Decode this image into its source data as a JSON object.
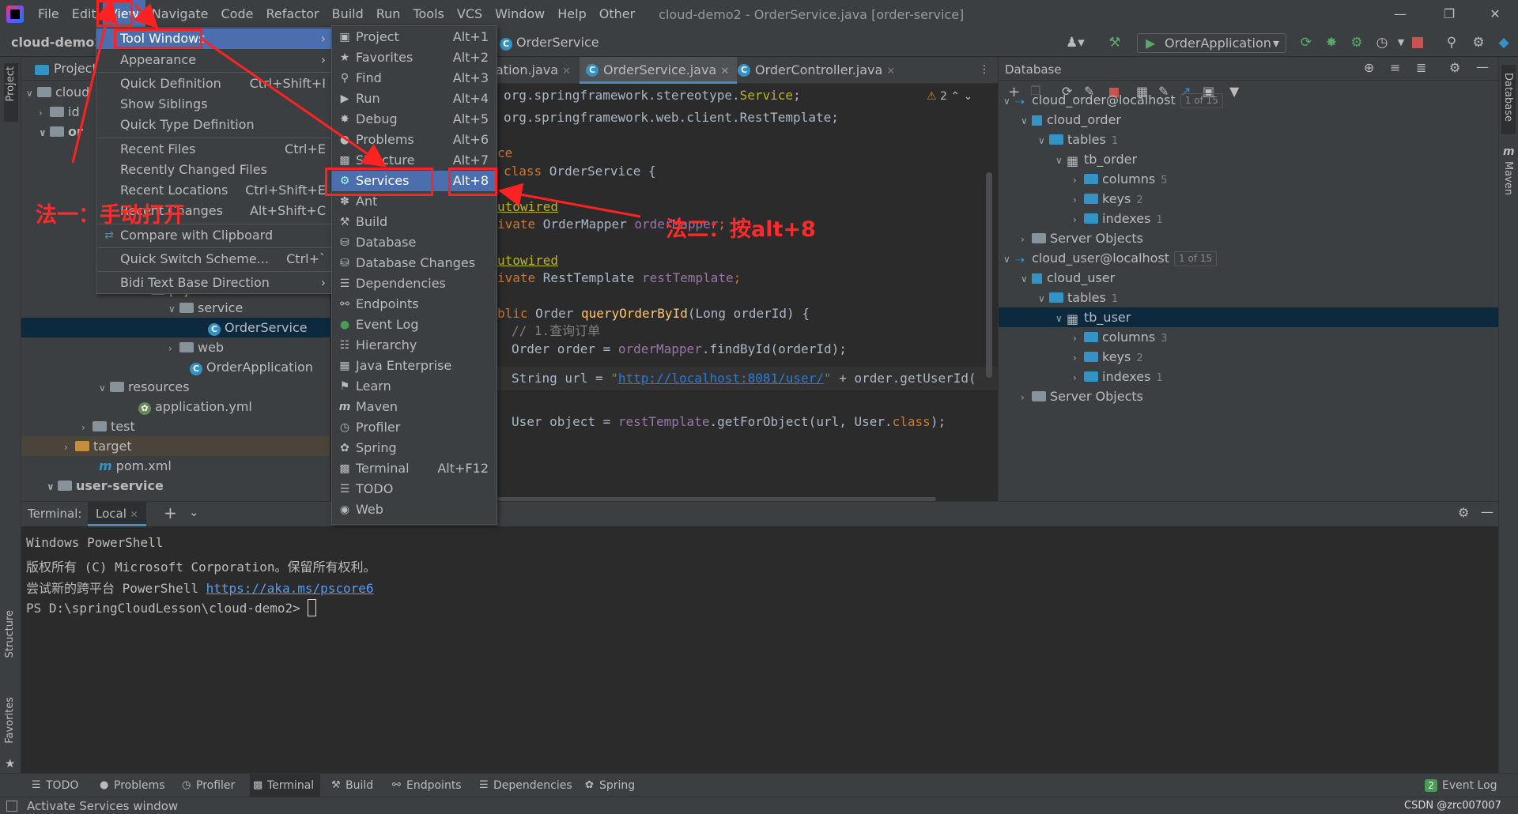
{
  "menubar": {
    "items": [
      "File",
      "Edit",
      "View",
      "Navigate",
      "Code",
      "Refactor",
      "Build",
      "Run",
      "Tools",
      "VCS",
      "Window",
      "Help",
      "Other"
    ],
    "window_title": "cloud-demo2 - OrderService.java [order-service]"
  },
  "navbar": {
    "root": "cloud-demo2",
    "crumb_class": "OrderService",
    "run_config": "OrderApplication"
  },
  "project": {
    "title": "Project",
    "rows": [
      {
        "label": "cloud"
      },
      {
        "label": "id"
      },
      {
        "label": "or"
      },
      {
        "label": "pojo"
      },
      {
        "label": "service"
      },
      {
        "label": "OrderService"
      },
      {
        "label": "web"
      },
      {
        "label": "OrderApplication"
      },
      {
        "label": "resources"
      },
      {
        "label": "application.yml"
      },
      {
        "label": "test"
      },
      {
        "label": "target"
      },
      {
        "label": "pom.xml"
      },
      {
        "label": "user-service"
      }
    ]
  },
  "editor": {
    "tabs": [
      "ation.java",
      "OrderService.java",
      "OrderController.java"
    ],
    "warning_count": "2",
    "lines": {
      "l1a": "org.springframework.stereotype.",
      "l1b": "Service",
      "l1c": ";",
      "l2": "org.springframework.web.client.RestTemplate;",
      "l3": "ce",
      "l4a": "class ",
      "l4b": "OrderService {",
      "l5": "utowired",
      "l6a": "ivate ",
      "l6b": "OrderMapper ",
      "l6c": "orderMapper",
      "l6d": ";",
      "l7": "utowired",
      "l8a": "ivate ",
      "l8b": "RestTemplate ",
      "l8c": "restTemplate",
      "l8d": ";",
      "l9a": "blic ",
      "l9b": "Order ",
      "l9c": "queryOrderById",
      "l9d": "(Long orderId) {",
      "l10": "// 1.查询订单",
      "l11a": "Order order = ",
      "l11b": "orderMapper",
      "l11c": ".findById(orderId);",
      "l12a": "String url = ",
      "l12b": "\"",
      "l12c": "http://localhost:8081/user/",
      "l12d": "\"",
      "l12e": " + order.getUserId(",
      "l13a": "User object = ",
      "l13b": "restTemplate",
      "l13c": ".getForObject(url, User.",
      "l13d": "class",
      "l13e": ");"
    }
  },
  "database": {
    "title": "Database",
    "rows": [
      {
        "label": "cloud_order@localhost",
        "badge": "1 of 15"
      },
      {
        "label": "cloud_order"
      },
      {
        "label": "tables",
        "count": "1"
      },
      {
        "label": "tb_order"
      },
      {
        "label": "columns",
        "count": "5"
      },
      {
        "label": "keys",
        "count": "2"
      },
      {
        "label": "indexes",
        "count": "1"
      },
      {
        "label": "Server Objects"
      },
      {
        "label": "cloud_user@localhost",
        "badge": "1 of 15"
      },
      {
        "label": "cloud_user"
      },
      {
        "label": "tables",
        "count": "1"
      },
      {
        "label": "tb_user"
      },
      {
        "label": "columns",
        "count": "3"
      },
      {
        "label": "keys",
        "count": "2"
      },
      {
        "label": "indexes",
        "count": "1"
      },
      {
        "label": "Server Objects"
      }
    ]
  },
  "stripes": {
    "left_top": "Project",
    "left_structure": "Structure",
    "left_favorites": "Favorites",
    "right_database": "Database",
    "right_maven": "Maven"
  },
  "terminal": {
    "label": "Terminal:",
    "tab": "Local",
    "lines": {
      "t1": "Windows PowerShell",
      "t2": "版权所有 (C) Microsoft Corporation。保留所有权利。",
      "t3a": "尝试新的跨平台 PowerShell ",
      "t3b": "https://aka.ms/pscore6",
      "t4": "PS D:\\springCloudLesson\\cloud-demo2> "
    }
  },
  "view_menu": {
    "items": [
      {
        "label": "Tool Windows",
        "shortcut": ""
      },
      {
        "label": "Appearance",
        "shortcut": ""
      },
      {
        "label": "Quick Definition",
        "shortcut": "Ctrl+Shift+I"
      },
      {
        "label": "Show Siblings",
        "shortcut": ""
      },
      {
        "label": "Quick Type Definition",
        "shortcut": ""
      },
      {
        "label": "Recent Files",
        "shortcut": "Ctrl+E"
      },
      {
        "label": "Recently Changed Files",
        "shortcut": ""
      },
      {
        "label": "Recent Locations",
        "shortcut": "Ctrl+Shift+E"
      },
      {
        "label": "Recent Changes",
        "shortcut": "Alt+Shift+C"
      },
      {
        "label": "Compare with Clipboard",
        "shortcut": ""
      },
      {
        "label": "Quick Switch Scheme...",
        "shortcut": "Ctrl+`"
      },
      {
        "label": "Bidi Text Base Direction",
        "shortcut": ""
      }
    ]
  },
  "tool_windows_menu": {
    "items": [
      {
        "label": "Project",
        "shortcut": "Alt+1"
      },
      {
        "label": "Favorites",
        "shortcut": "Alt+2"
      },
      {
        "label": "Find",
        "shortcut": "Alt+3"
      },
      {
        "label": "Run",
        "shortcut": "Alt+4"
      },
      {
        "label": "Debug",
        "shortcut": "Alt+5"
      },
      {
        "label": "Problems",
        "shortcut": "Alt+6"
      },
      {
        "label": "Structure",
        "shortcut": "Alt+7"
      },
      {
        "label": "Services",
        "shortcut": "Alt+8"
      },
      {
        "label": "Ant",
        "shortcut": ""
      },
      {
        "label": "Build",
        "shortcut": ""
      },
      {
        "label": "Database",
        "shortcut": ""
      },
      {
        "label": "Database Changes",
        "shortcut": ""
      },
      {
        "label": "Dependencies",
        "shortcut": ""
      },
      {
        "label": "Endpoints",
        "shortcut": ""
      },
      {
        "label": "Event Log",
        "shortcut": ""
      },
      {
        "label": "Hierarchy",
        "shortcut": ""
      },
      {
        "label": "Java Enterprise",
        "shortcut": ""
      },
      {
        "label": "Learn",
        "shortcut": ""
      },
      {
        "label": "Maven",
        "shortcut": ""
      },
      {
        "label": "Profiler",
        "shortcut": ""
      },
      {
        "label": "Spring",
        "shortcut": ""
      },
      {
        "label": "Terminal",
        "shortcut": "Alt+F12"
      },
      {
        "label": "TODO",
        "shortcut": ""
      },
      {
        "label": "Web",
        "shortcut": ""
      }
    ]
  },
  "annotations": {
    "method1": "法一：手动打开",
    "method2": "法二：按alt+8"
  },
  "bottom_tools": [
    "TODO",
    "Problems",
    "Profiler",
    "Terminal",
    "Build",
    "Endpoints",
    "Dependencies",
    "Spring"
  ],
  "event_log": {
    "count": "2",
    "label": "Event Log"
  },
  "status": {
    "text": "Activate Services window",
    "watermark": "CSDN @zrc007007"
  },
  "colors": {
    "highlight": "#4b6eaf",
    "annotation_red": "#ff2222",
    "bg_dark": "#2b2b2b",
    "bg_panel": "#3c3f41"
  }
}
